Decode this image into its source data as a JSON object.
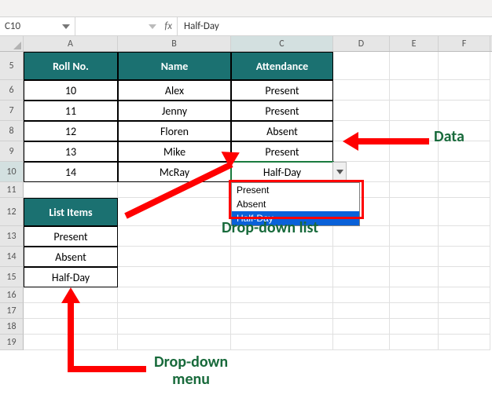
{
  "cell_ref": "C10",
  "formula_value": "Half-Day",
  "fx_label": "fx",
  "columns": [
    "A",
    "B",
    "C",
    "D",
    "E",
    "F"
  ],
  "row_numbers": [
    "5",
    "6",
    "7",
    "8",
    "9",
    "10",
    "11",
    "12",
    "13",
    "14",
    "15",
    "16",
    "17",
    "18",
    "19"
  ],
  "table": {
    "headers": {
      "roll": "Roll No.",
      "name": "Name",
      "att": "Attendance"
    },
    "rows": [
      {
        "roll": "10",
        "name": "Alex",
        "att": "Present"
      },
      {
        "roll": "11",
        "name": "Jenny",
        "att": "Present"
      },
      {
        "roll": "12",
        "name": "Floren",
        "att": "Absent"
      },
      {
        "roll": "13",
        "name": "Mike",
        "att": "Present"
      },
      {
        "roll": "14",
        "name": "McRay",
        "att": "Half-Day"
      }
    ]
  },
  "list_items": {
    "header": "List Items",
    "items": [
      "Present",
      "Absent",
      "Half-Day"
    ]
  },
  "dropdown": {
    "options": [
      "Present",
      "Absent",
      "Half-Day"
    ],
    "highlighted_index": 2
  },
  "annotations": {
    "data": "Data",
    "dropdown_list": "Drop-down list",
    "dropdown_menu": "Drop-down\nmenu"
  },
  "chart_data": {
    "type": "table",
    "headers": [
      "Roll No.",
      "Name",
      "Attendance"
    ],
    "rows": [
      [
        "10",
        "Alex",
        "Present"
      ],
      [
        "11",
        "Jenny",
        "Present"
      ],
      [
        "12",
        "Floren",
        "Absent"
      ],
      [
        "13",
        "Mike",
        "Present"
      ],
      [
        "14",
        "McRay",
        "Half-Day"
      ]
    ],
    "list_items_table": {
      "header": "List Items",
      "rows": [
        "Present",
        "Absent",
        "Half-Day"
      ]
    }
  }
}
